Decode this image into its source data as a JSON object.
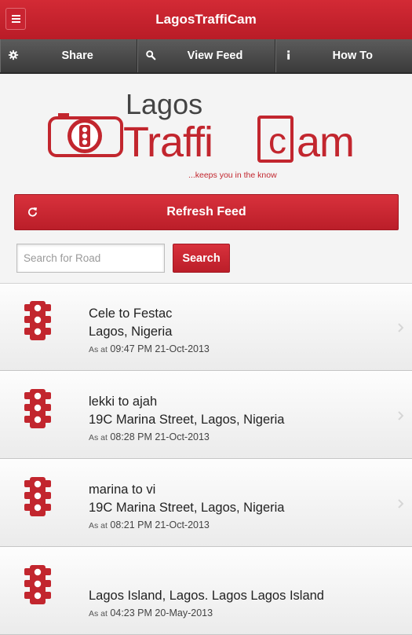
{
  "app": {
    "title": "LagosTraffiCam"
  },
  "nav": [
    {
      "label": "Share",
      "icon": "gear-icon"
    },
    {
      "label": "View Feed",
      "icon": "search-icon"
    },
    {
      "label": "How To",
      "icon": "info-icon"
    }
  ],
  "logo": {
    "line1": "Lagos",
    "traffi": "Traffi",
    "c": "c",
    "am": "am",
    "tagline": "...keeps you in the know"
  },
  "refresh": {
    "label": "Refresh Feed",
    "icon": "refresh-icon"
  },
  "search": {
    "placeholder": "Search for Road",
    "value": "",
    "button": "Search"
  },
  "feed": [
    {
      "title": "Cele to Festac",
      "location": "Lagos, Nigeria",
      "as_at": "As at",
      "time": "09:47 PM 21-Oct-2013"
    },
    {
      "title": "lekki to ajah",
      "location": "19C Marina Street, Lagos, Nigeria",
      "as_at": "As at",
      "time": "08:28 PM 21-Oct-2013"
    },
    {
      "title": "marina to vi",
      "location": "19C Marina Street, Lagos, Nigeria",
      "as_at": "As at",
      "time": "08:21 PM 21-Oct-2013"
    },
    {
      "title": "",
      "location": "Lagos Island, Lagos. Lagos Lagos Island",
      "as_at": "As at",
      "time": "04:23 PM 20-May-2013"
    }
  ],
  "colors": {
    "brand_red": "#c2262e",
    "nav_dark": "#444444"
  }
}
